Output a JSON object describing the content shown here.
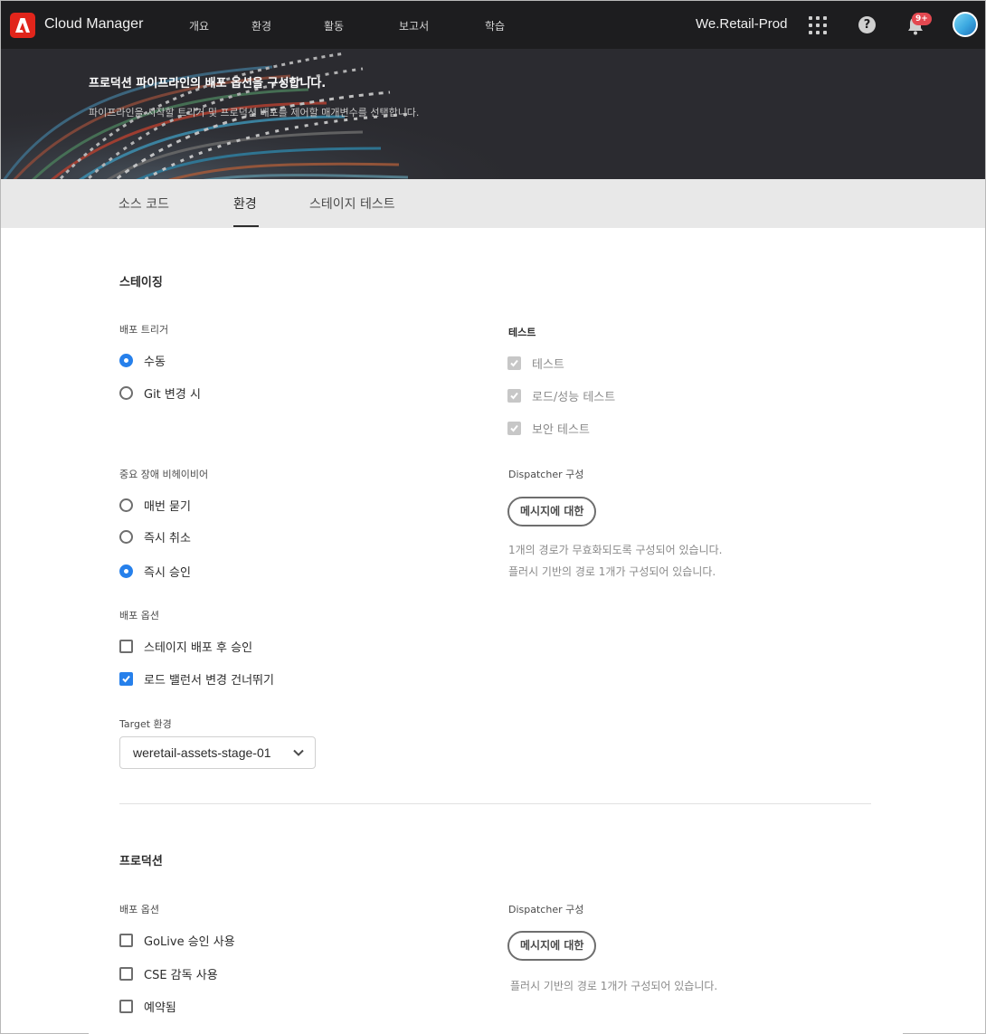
{
  "header": {
    "app_title": "Cloud Manager",
    "nav": [
      "개요",
      "환경",
      "활동",
      "보고서",
      "학습"
    ],
    "org_name": "We.Retail-Prod",
    "notification_count": "9+",
    "icons": [
      "adobe-logo",
      "apps-grid-icon",
      "help-icon",
      "bell-icon",
      "avatar"
    ]
  },
  "hero": {
    "title": "프로덕션 파이프라인의 배포 옵션을 구성합니다.",
    "subtitle": "파이프라인을 시작할 트리거 및 프로덕션 배포를 제어할 매개변수를 선택합니다."
  },
  "tabs": {
    "source": "소스 코드",
    "env": "환경",
    "stage_test": "스테이지 테스트",
    "active": "환경"
  },
  "staging": {
    "title": "스테이징",
    "deploy_trigger": {
      "label": "배포 트리거",
      "manual": "수동",
      "git": "Git 변경 시",
      "selected": "수동"
    },
    "tests": {
      "label": "테스트",
      "test": "테스트",
      "load": "로드/성능 테스트",
      "security": "보안 테스트"
    },
    "failure_behavior": {
      "label": "중요 장애 비헤이비어",
      "ask": "매번 묻기",
      "cancel": "즉시 취소",
      "approve": "즉시 승인",
      "selected": "즉시 승인"
    },
    "dispatcher": {
      "label": "Dispatcher 구성",
      "button": "메시지에 대한",
      "line1": "1개의 경로가 무효화되도록 구성되어 있습니다.",
      "line2": "플러시 기반의 경로 1개가 구성되어 있습니다."
    },
    "deploy_options": {
      "label": "배포 옵션",
      "approve_after": "스테이지 배포 후 승인",
      "skip_lb": "로드 밸런서 변경 건너뛰기",
      "skip_lb_checked": true,
      "approve_after_checked": false
    },
    "target": {
      "label": "Target 환경",
      "value": "weretail-assets-stage-01"
    }
  },
  "production": {
    "title": "프로덕션",
    "deploy_options": {
      "label": "배포 옵션",
      "golive": "GoLive 승인 사용",
      "cse": "CSE 감독 사용",
      "scheduled": "예약됨"
    },
    "dispatcher": {
      "label": "Dispatcher 구성",
      "button": "메시지에 대한",
      "line1": "플러시 기반의 경로 1개가 구성되어 있습니다."
    }
  },
  "colors": {
    "accent": "#2680eb",
    "topbar": "#1d1d1f",
    "hero": "#2b2b30",
    "adobe_red": "#e1251b"
  }
}
